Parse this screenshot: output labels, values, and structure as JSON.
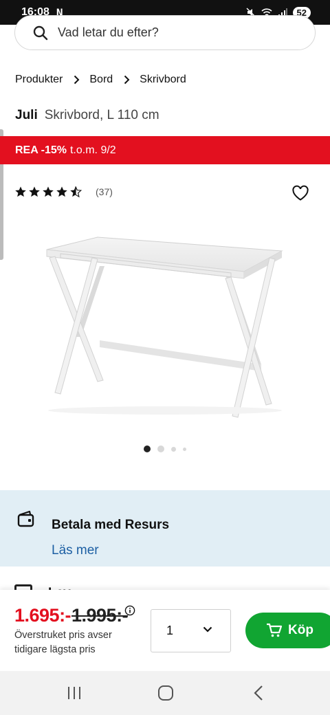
{
  "status_bar": {
    "time": "16:08",
    "notification_glyph": "N",
    "battery": "52"
  },
  "search": {
    "placeholder": "Vad letar du efter?"
  },
  "breadcrumb": [
    "Produkter",
    "Bord",
    "Skrivbord"
  ],
  "product": {
    "brand": "Juli",
    "name": "Skrivbord, L 110 cm"
  },
  "promo_banner": {
    "strong": "REA -15%",
    "rest": "t.o.m. 9/2",
    "color": "#e3101f"
  },
  "rating": {
    "stars_value": 4.5,
    "stars_max": 5,
    "count": "(37)"
  },
  "image_carousel": {
    "slides": 4,
    "active_index": 0
  },
  "payment": {
    "title": "Betala med Resurs",
    "link": "Läs mer"
  },
  "next_section_peek": {
    "title": "Lev"
  },
  "buy_bar": {
    "price_now": "1.695:-",
    "price_old": "1.995:-",
    "note": "Överstruket pris avser tidigare lägsta pris",
    "quantity": "1",
    "buy_label": "Köp",
    "buy_color": "#11a532"
  },
  "icons": {
    "search": "search-icon",
    "chevron": "chevron-right-icon",
    "heart": "heart-icon",
    "wallet": "wallet-icon",
    "info": "info-icon",
    "cart": "cart-icon",
    "nav": [
      "recent-apps-icon",
      "home-icon",
      "back-icon"
    ]
  }
}
